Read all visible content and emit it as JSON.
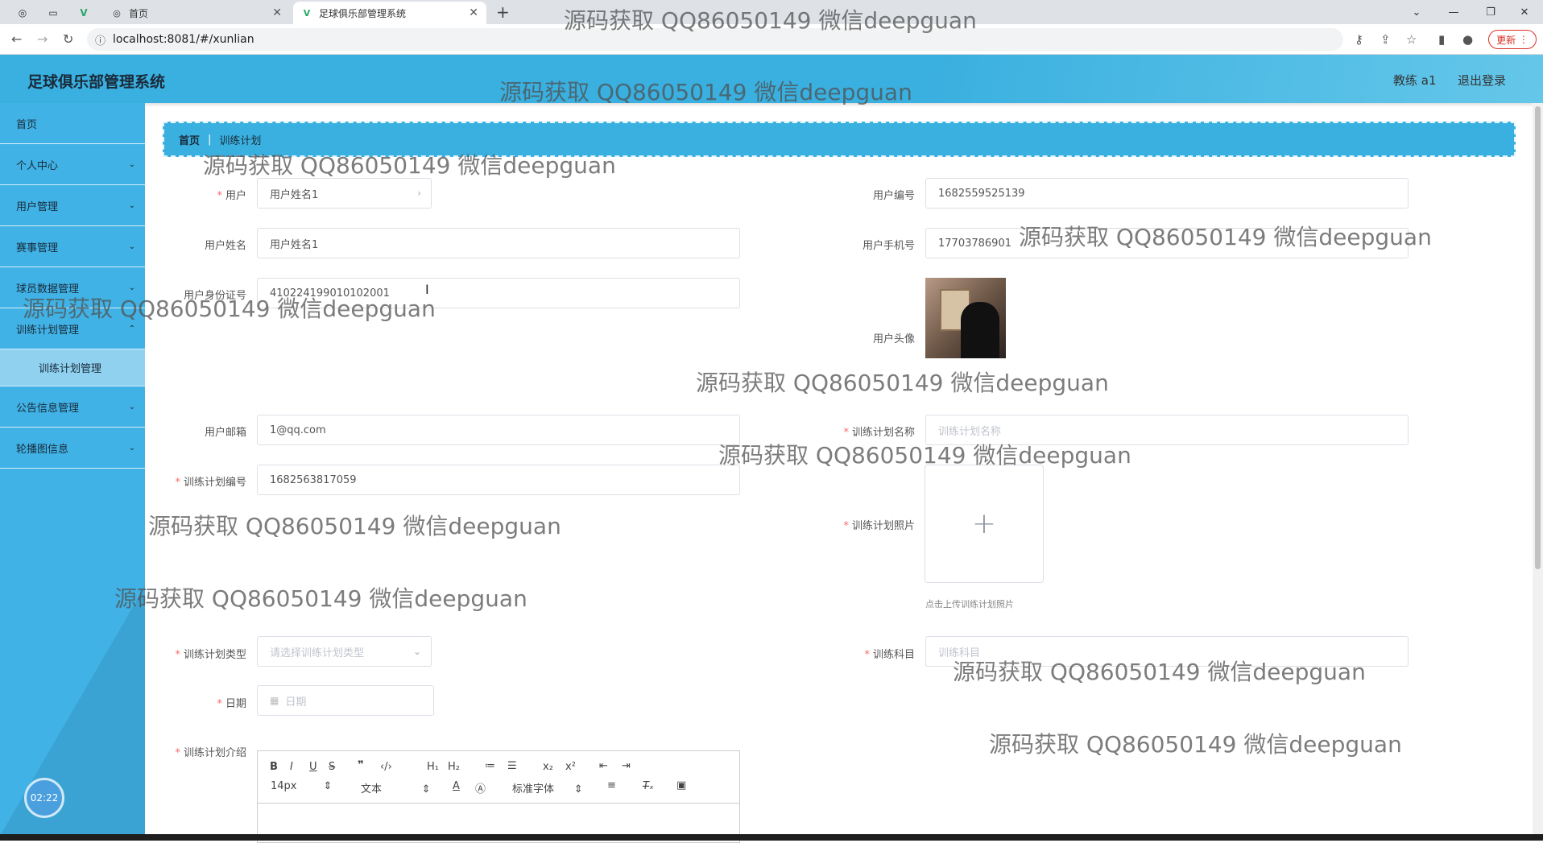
{
  "browser": {
    "tabs": [
      {
        "title": "首页"
      },
      {
        "title": "足球俱乐部管理系统"
      }
    ],
    "url": "localhost:8081/#/xunlian",
    "update_label": "更新"
  },
  "header": {
    "title": "足球俱乐部管理系统",
    "user": "教练 a1",
    "logout": "退出登录"
  },
  "sidebar": {
    "items": [
      {
        "label": "首页"
      },
      {
        "label": "个人中心"
      },
      {
        "label": "用户管理"
      },
      {
        "label": "赛事管理"
      },
      {
        "label": "球员数据管理"
      },
      {
        "label": "训练计划管理"
      },
      {
        "label": "训练计划管理"
      },
      {
        "label": "公告信息管理"
      },
      {
        "label": "轮播图信息"
      }
    ],
    "clock": "02:22"
  },
  "breadcrumb": {
    "home": "首页",
    "current": "训练计划"
  },
  "form": {
    "user_label": "用户",
    "user_value": "用户姓名1",
    "user_no_label": "用户编号",
    "user_no_value": "1682559525139",
    "user_name_label": "用户姓名",
    "user_name_value": "用户姓名1",
    "phone_label": "用户手机号",
    "phone_value": "17703786901",
    "id_label": "用户身份证号",
    "id_value": "410224199010102001",
    "avatar_label": "用户头像",
    "email_label": "用户邮箱",
    "email_value": "1@qq.com",
    "plan_name_label": "训练计划名称",
    "plan_name_placeholder": "训练计划名称",
    "plan_no_label": "训练计划编号",
    "plan_no_value": "1682563817059",
    "plan_photo_label": "训练计划照片",
    "upload_hint": "点击上传训练计划照片",
    "plan_type_label": "训练计划类型",
    "plan_type_placeholder": "请选择训练计划类型",
    "subject_label": "训练科目",
    "subject_placeholder": "训练科目",
    "date_label": "日期",
    "date_placeholder": "日期",
    "intro_label": "训练计划介绍"
  },
  "editor": {
    "font_size": "14px",
    "text_style": "文本",
    "font_family": "标准字体"
  },
  "watermark": "源码获取 QQ86050149 微信deepguan"
}
